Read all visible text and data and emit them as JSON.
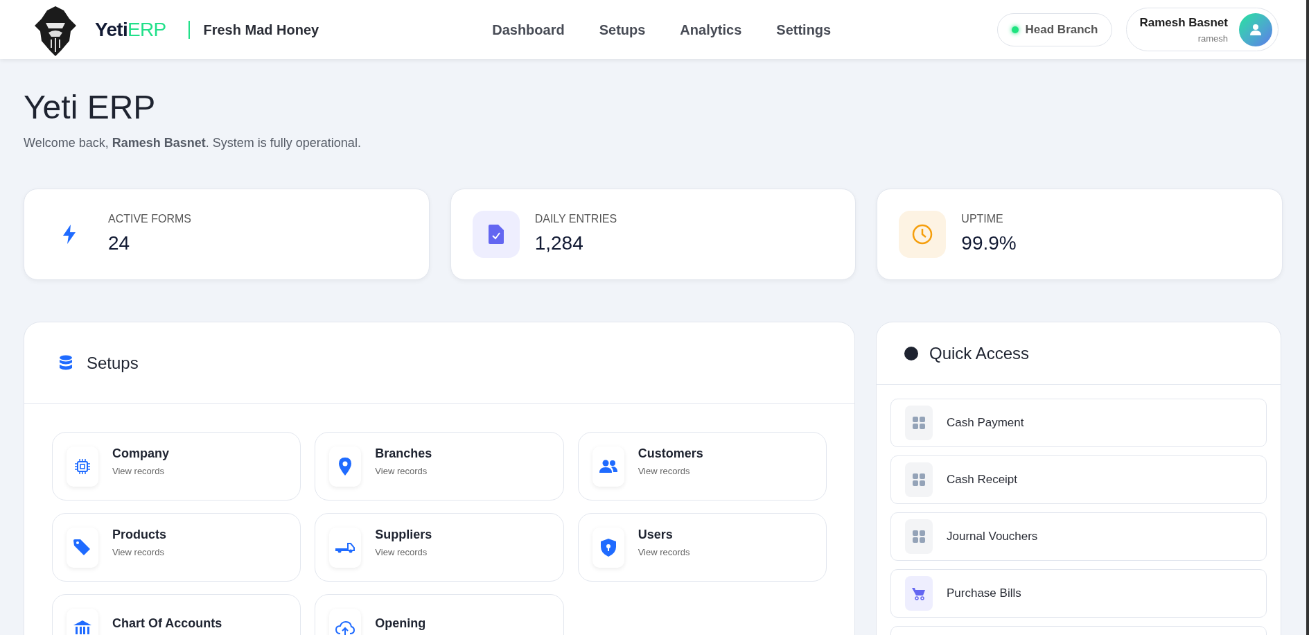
{
  "header": {
    "brand_main": "Yeti",
    "brand_accent": "ERP",
    "company": "Fresh Mad Honey",
    "nav": [
      {
        "label": "Dashboard",
        "selected": false
      },
      {
        "label": "Setups",
        "selected": false
      },
      {
        "label": "Analytics",
        "selected": false
      },
      {
        "label": "Settings",
        "selected": false
      }
    ],
    "branch": {
      "label": "Head Branch",
      "online": true
    },
    "user": {
      "name": "Ramesh Basnet",
      "username": "ramesh"
    }
  },
  "page": {
    "title": "Yeti ERP",
    "welcome": "Welcome back, **Ramesh Basnet**. System is fully operational."
  },
  "stats": [
    {
      "label": "ACTIVE FORMS",
      "value": "24"
    },
    {
      "label": "DAILY ENTRIES",
      "value": "1,284"
    },
    {
      "label": "UPTIME",
      "value": "99.9%"
    }
  ],
  "setups": {
    "title": "Setups",
    "items": [
      {
        "title": "Company",
        "subtitle": "View records"
      },
      {
        "title": "Branches",
        "subtitle": "View records"
      },
      {
        "title": "Customers",
        "subtitle": "View records"
      },
      {
        "title": "Products",
        "subtitle": "View records"
      },
      {
        "title": "Suppliers",
        "subtitle": "View records"
      },
      {
        "title": "Users",
        "subtitle": "View records"
      },
      {
        "title": "Chart Of Accounts"
      },
      {
        "title": "Opening"
      }
    ]
  },
  "quick_access": {
    "title": "Quick Access",
    "items": [
      {
        "label": "Cash Payment",
        "kind": "grid"
      },
      {
        "label": "Cash Receipt",
        "kind": "grid"
      },
      {
        "label": "Journal Vouchers",
        "kind": "grid"
      },
      {
        "label": "Purchase Bills",
        "kind": "cart"
      }
    ]
  }
}
